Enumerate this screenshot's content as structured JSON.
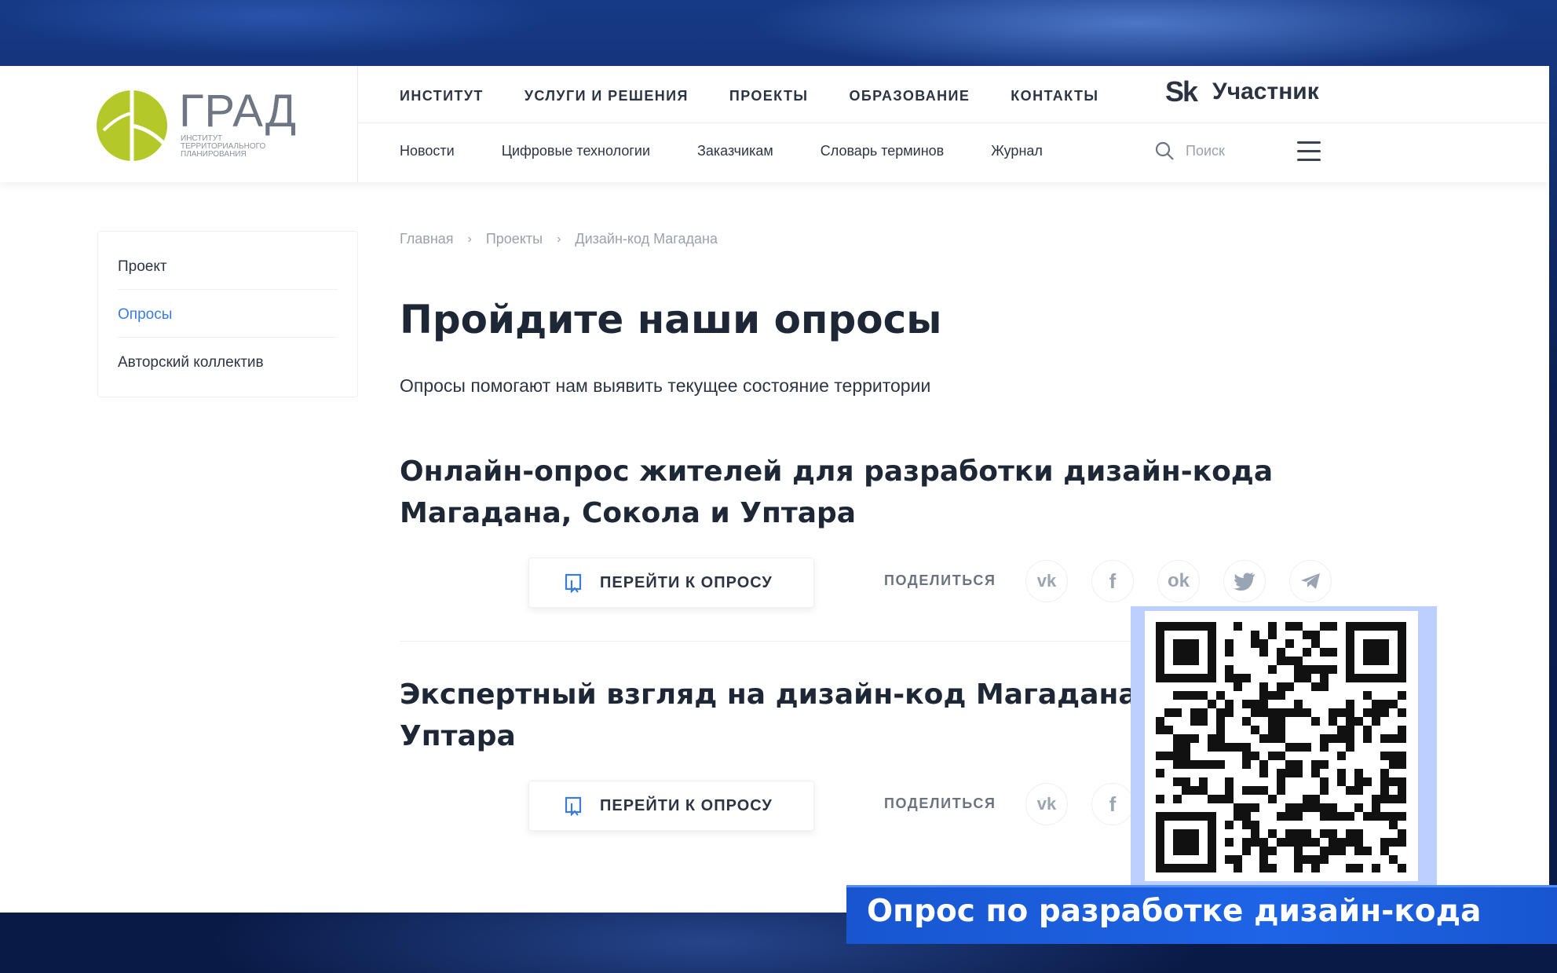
{
  "logo": {
    "name": "ГРАД",
    "subtitle_lines": [
      "ИНСТИТУТ",
      "ТЕРРИТОРИАЛЬНОГО",
      "ПЛАНИРОВАНИЯ"
    ]
  },
  "top_nav": [
    "ИНСТИТУТ",
    "УСЛУГИ И РЕШЕНИЯ",
    "ПРОЕКТЫ",
    "ОБРАЗОВАНИЕ",
    "КОНТАКТЫ"
  ],
  "skolkovo": {
    "logo": "Sk",
    "label": "Участник"
  },
  "sub_nav": [
    "Новости",
    "Цифровые технологии",
    "Заказчикам",
    "Словарь терминов",
    "Журнал"
  ],
  "search": {
    "placeholder": "Поиск"
  },
  "sidebar": {
    "items": [
      {
        "label": "Проект",
        "active": false
      },
      {
        "label": "Опросы",
        "active": true
      },
      {
        "label": "Авторский коллектив",
        "active": false
      }
    ]
  },
  "breadcrumb": [
    "Главная",
    "Проекты",
    "Дизайн-код Магадана"
  ],
  "page": {
    "title": "Пройдите наши опросы",
    "intro": "Опросы помогают нам выявить текущее состояние территории"
  },
  "surveys": [
    {
      "title_lines": [
        "Онлайн-опрос жителей для разработки дизайн-кода",
        "Магадана, Сокола и Уптара"
      ],
      "button": "ПЕРЕЙТИ К ОПРОСУ",
      "share": "ПОДЕЛИТЬСЯ"
    },
    {
      "title_lines": [
        "Экспертный взгляд на дизайн-код Магадана, С",
        "Уптара"
      ],
      "button": "ПЕРЕЙТИ К ОПРОСУ",
      "share": "ПОДЕЛИТЬСЯ"
    }
  ],
  "social_icons": [
    "vk-icon",
    "facebook-icon",
    "odnoklassniki-icon",
    "twitter-icon",
    "telegram-icon"
  ],
  "caption": "Опрос по разработке дизайн-кода",
  "colors": {
    "logo_green": "#b4c928",
    "accent_blue": "#3b7be0",
    "banner_blue": "#1e64e6",
    "text_dark": "#1e2735"
  }
}
